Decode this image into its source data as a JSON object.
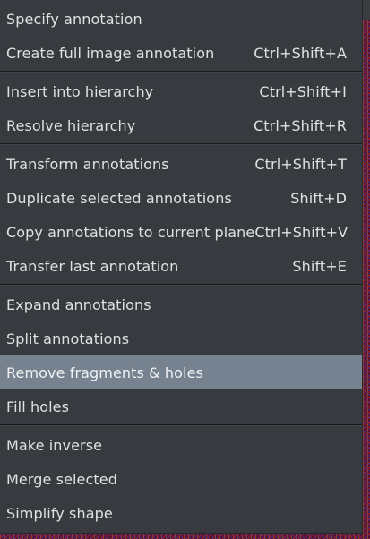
{
  "menu": {
    "groups": [
      {
        "items": [
          {
            "label": "Specify annotation",
            "shortcut": ""
          },
          {
            "label": "Create full image annotation",
            "shortcut": "Ctrl+Shift+A"
          }
        ]
      },
      {
        "items": [
          {
            "label": "Insert into hierarchy",
            "shortcut": "Ctrl+Shift+I"
          },
          {
            "label": "Resolve hierarchy",
            "shortcut": "Ctrl+Shift+R"
          }
        ]
      },
      {
        "items": [
          {
            "label": "Transform annotations",
            "shortcut": "Ctrl+Shift+T"
          },
          {
            "label": "Duplicate selected annotations",
            "shortcut": "Shift+D"
          },
          {
            "label": "Copy annotations to current plane",
            "shortcut": "Ctrl+Shift+V"
          },
          {
            "label": "Transfer last annotation",
            "shortcut": "Shift+E"
          }
        ]
      },
      {
        "items": [
          {
            "label": "Expand annotations",
            "shortcut": ""
          },
          {
            "label": "Split annotations",
            "shortcut": ""
          },
          {
            "label": "Remove fragments & holes",
            "shortcut": "",
            "highlighted": true
          },
          {
            "label": "Fill holes",
            "shortcut": ""
          }
        ]
      },
      {
        "items": [
          {
            "label": "Make inverse",
            "shortcut": ""
          },
          {
            "label": "Merge selected",
            "shortcut": ""
          },
          {
            "label": "Simplify shape",
            "shortcut": ""
          }
        ]
      }
    ],
    "colors": {
      "background": "#373a3e",
      "highlight": "#76828f",
      "text": "#dfe1e4"
    }
  }
}
